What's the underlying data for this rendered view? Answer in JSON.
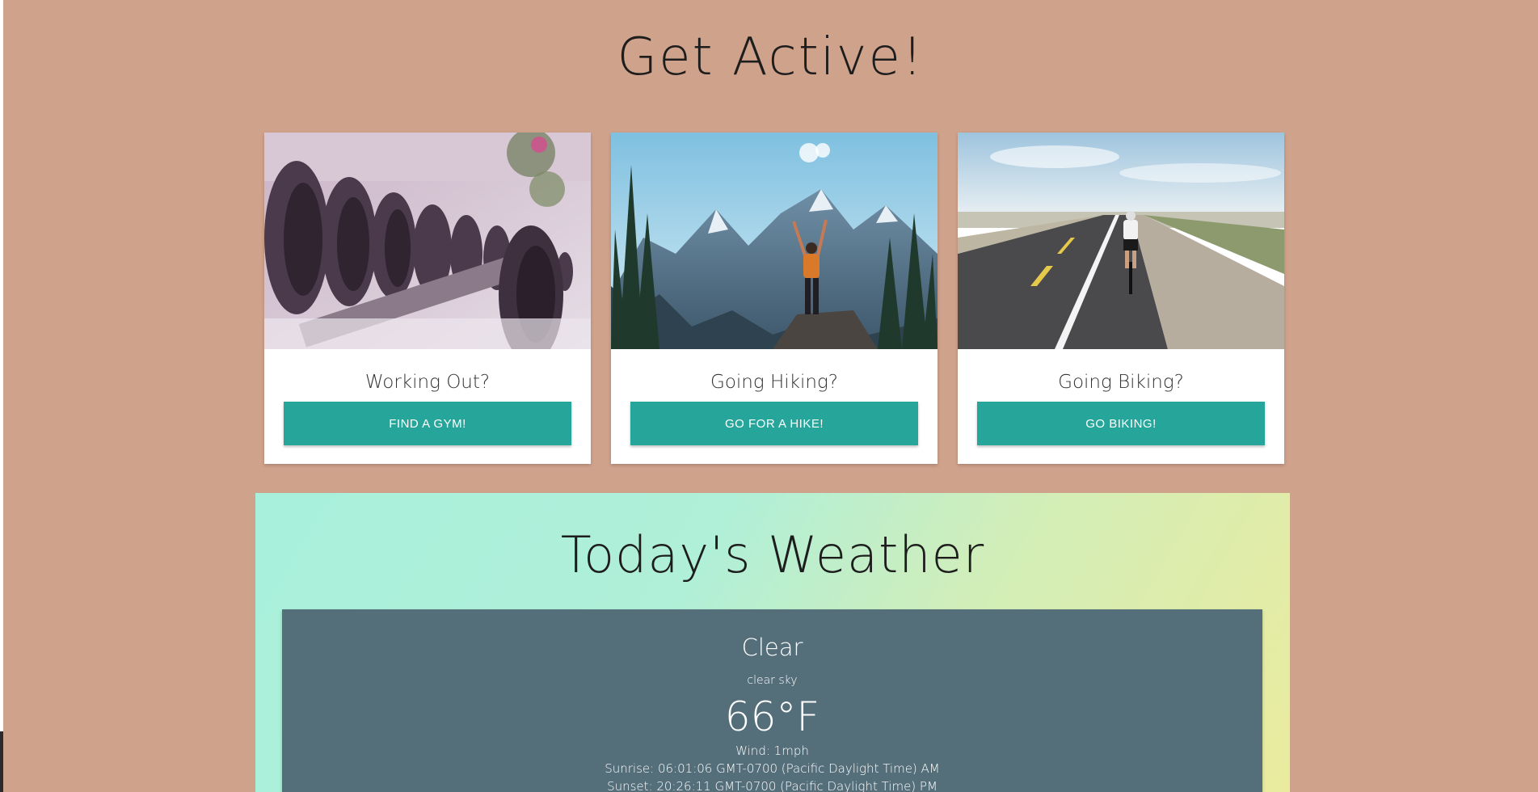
{
  "header": {
    "title": "Get Active!"
  },
  "cards": [
    {
      "title": "Working Out?",
      "button": "FIND A GYM!",
      "image": "dumbbells-rack-photo"
    },
    {
      "title": "Going Hiking?",
      "button": "GO FOR A HIKE!",
      "image": "mountain-hiker-photo"
    },
    {
      "title": "Going Biking?",
      "button": "GO BIKING!",
      "image": "road-cyclist-photo"
    }
  ],
  "weather": {
    "title": "Today's Weather",
    "main": "Clear",
    "description": "clear sky",
    "temperature": "66°F",
    "wind": "Wind: 1mph",
    "sunrise": "Sunrise: 06:01:06 GMT-0700 (Pacific Daylight Time) AM",
    "sunset": "Sunset: 20:26:11 GMT-0700 (Pacific Daylight Time) PM"
  },
  "colors": {
    "page_background": "#cfa28b",
    "button": "#26a69a",
    "weather_card": "#546e7a"
  }
}
